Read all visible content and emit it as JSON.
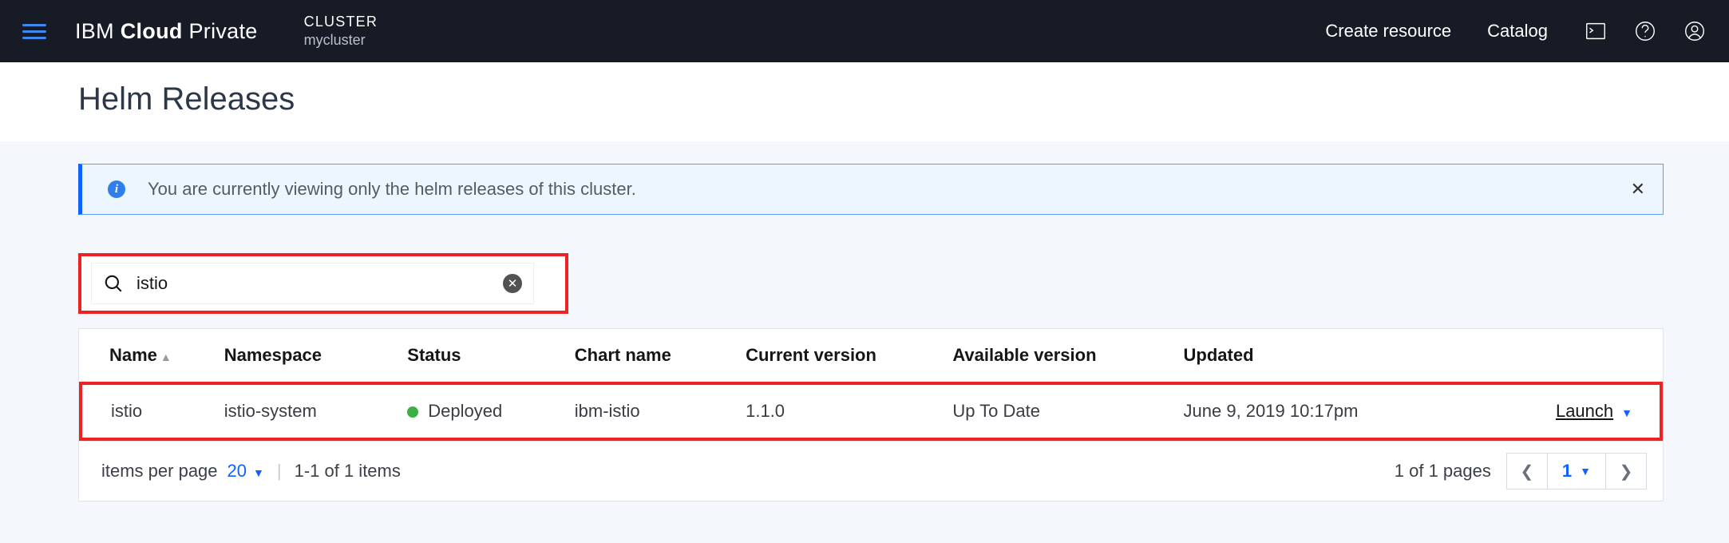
{
  "header": {
    "brand_plain1": "IBM ",
    "brand_bold": "Cloud",
    "brand_plain2": " Private",
    "cluster_label": "CLUSTER",
    "cluster_name": "mycluster",
    "links": {
      "create": "Create resource",
      "catalog": "Catalog"
    }
  },
  "page": {
    "title": "Helm Releases"
  },
  "banner": {
    "message": "You are currently viewing only the helm releases of this cluster.",
    "close": "✕"
  },
  "search": {
    "value": "istio"
  },
  "table": {
    "headers": {
      "name": "Name",
      "namespace": "Namespace",
      "status": "Status",
      "chart": "Chart name",
      "current": "Current version",
      "available": "Available version",
      "updated": "Updated"
    },
    "rows": [
      {
        "name": "istio",
        "namespace": "istio-system",
        "status": "Deployed",
        "chart": "ibm-istio",
        "current": "1.1.0",
        "available": "Up To Date",
        "updated": "June 9, 2019 10:17pm",
        "action": "Launch"
      }
    ]
  },
  "footer": {
    "items_per_page_label": "items per page",
    "items_per_page_value": "20",
    "range": "1-1 of 1 items",
    "page_of": "1 of 1 pages",
    "page_num": "1"
  }
}
